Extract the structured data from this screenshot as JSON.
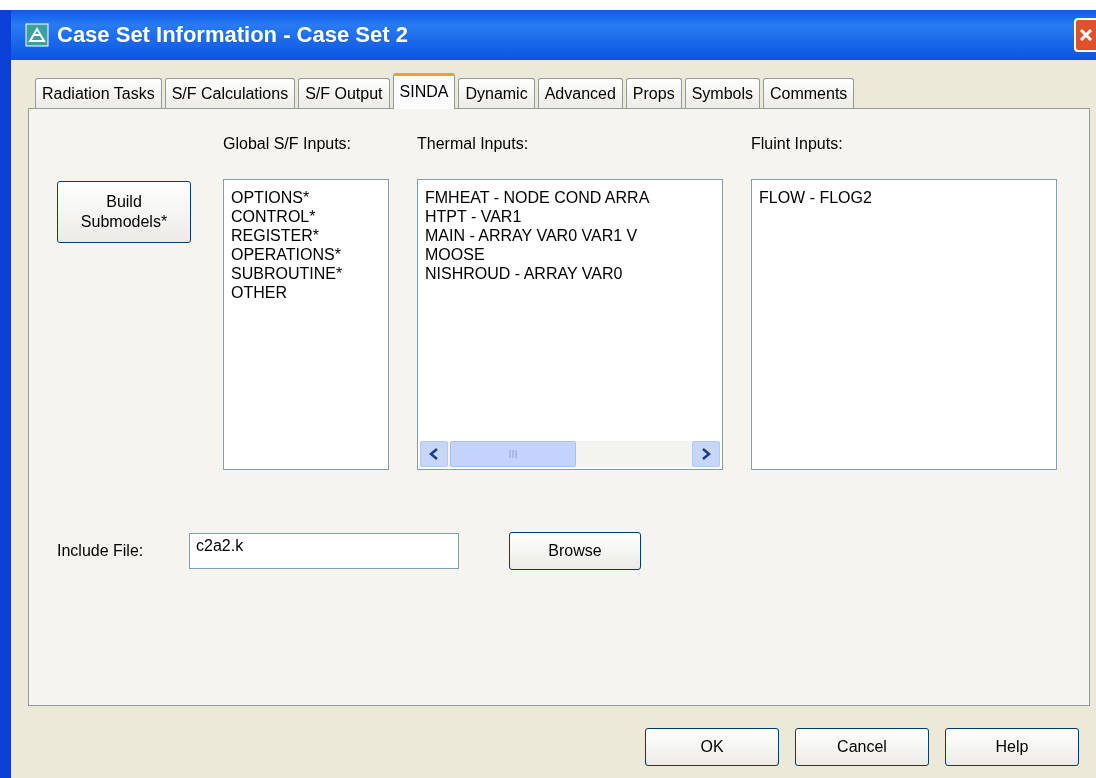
{
  "window": {
    "title": "Case Set Information - Case Set 2"
  },
  "tabs": [
    {
      "label": "Radiation Tasks",
      "selected": false
    },
    {
      "label": "S/F Calculations",
      "selected": false
    },
    {
      "label": "S/F Output",
      "selected": false
    },
    {
      "label": "SINDA",
      "selected": true
    },
    {
      "label": "Dynamic",
      "selected": false
    },
    {
      "label": "Advanced",
      "selected": false
    },
    {
      "label": "Props",
      "selected": false
    },
    {
      "label": "Symbols",
      "selected": false
    },
    {
      "label": "Comments",
      "selected": false
    }
  ],
  "build_button": "Build Submodels*",
  "lists": [
    {
      "label": "Global S/F Inputs:",
      "items": [
        "OPTIONS*",
        "CONTROL*",
        "REGISTER*",
        "OPERATIONS*",
        "SUBROUTINE*",
        "OTHER"
      ],
      "horizontal_scroll": false
    },
    {
      "label": "Thermal Inputs:",
      "items": [
        "FMHEAT - NODE COND ARRA",
        "HTPT - VAR1",
        "MAIN - ARRAY VAR0 VAR1 V",
        "MOOSE",
        "NISHROUD - ARRAY VAR0"
      ],
      "horizontal_scroll": true
    },
    {
      "label": "Fluint Inputs:",
      "items": [
        "FLOW - FLOG2"
      ],
      "horizontal_scroll": false
    }
  ],
  "include_file": {
    "label": "Include File:",
    "value": "c2a2.k"
  },
  "browse_button": "Browse",
  "buttons": [
    "OK",
    "Cancel",
    "Help"
  ]
}
